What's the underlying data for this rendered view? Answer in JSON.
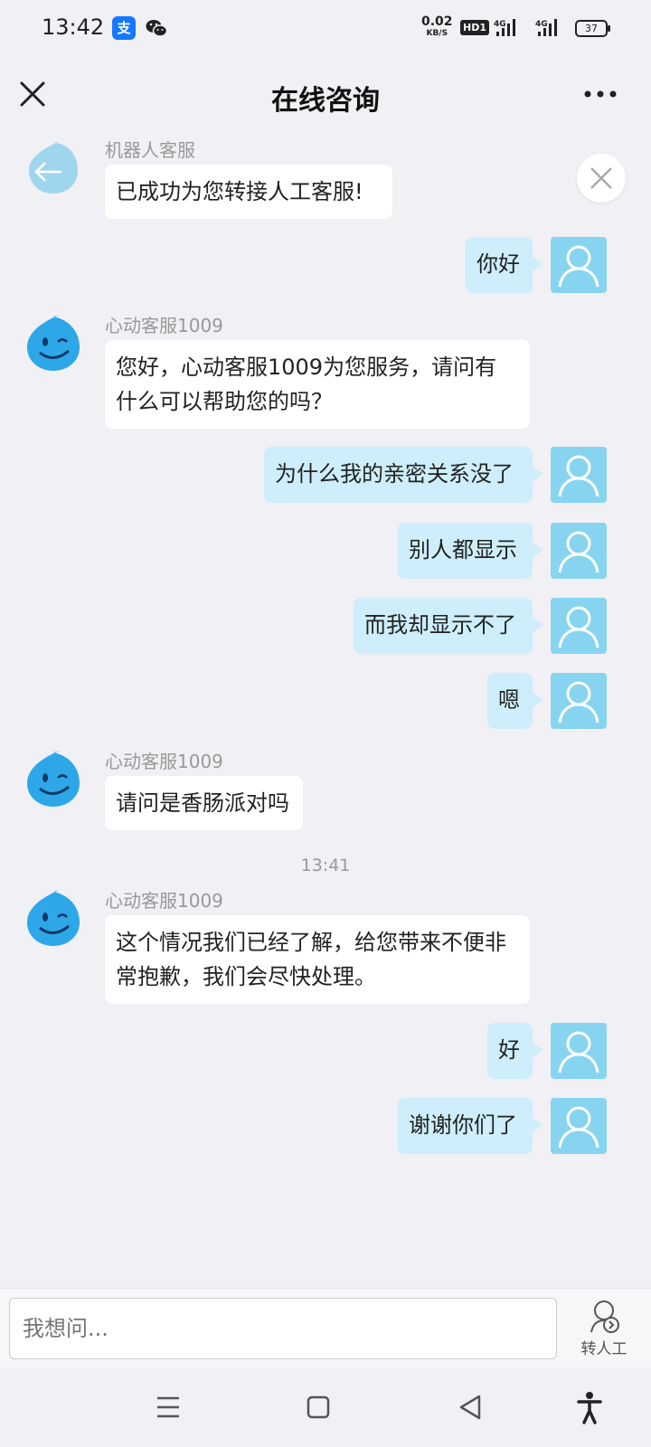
{
  "status": {
    "time": "13:42",
    "speed_value": "0.02",
    "speed_unit": "KB/S",
    "hd": "HD1",
    "network1": "4G",
    "network2": "4G",
    "battery": "37",
    "alipay_char": "支"
  },
  "nav": {
    "title": "在线咨询",
    "close_icon": "close-icon",
    "more_icon": "more-dots-icon"
  },
  "chat": {
    "messages": [
      {
        "sender": "机器人客服",
        "text": "已成功为您转接人工客服!"
      },
      {
        "text": "你好"
      },
      {
        "sender": "心动客服1009",
        "text_line1": "您好，心动客服1009为您服务，请问有",
        "text_line2": "什么可以帮助您的吗？"
      },
      {
        "text": "为什么我的亲密关系没了"
      },
      {
        "text": "别人都显示"
      },
      {
        "text": "而我却显示不了"
      },
      {
        "text": "嗯"
      },
      {
        "sender": "心动客服1009",
        "text": "请问是香肠派对吗"
      },
      {
        "time": "13:41"
      },
      {
        "sender": "心动客服1009",
        "text_line1": "这个情况我们已经了解，给您带来不便非",
        "text_line2": "常抱歉，我们会尽快处理。"
      },
      {
        "text": "好"
      },
      {
        "text": "谢谢你们了"
      }
    ]
  },
  "input": {
    "placeholder": "我想问...",
    "transfer_label": "转人工"
  },
  "colors": {
    "user_bubble": "#cdeefa",
    "agent_bubble": "#ffffff",
    "background": "#f0f0f5",
    "avatar_blue": "#87d4f0"
  }
}
